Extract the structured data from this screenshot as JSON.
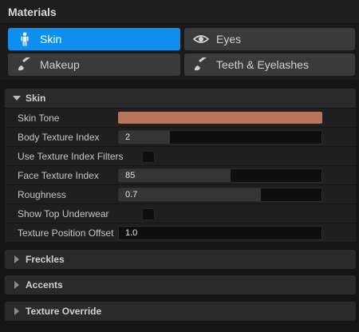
{
  "panel": {
    "title": "Materials"
  },
  "tabs": [
    {
      "label": "Skin",
      "icon": "person-icon",
      "active": true
    },
    {
      "label": "Eyes",
      "icon": "eye-icon",
      "active": false
    },
    {
      "label": "Makeup",
      "icon": "brush-icon",
      "active": false
    },
    {
      "label": "Teeth & Eyelashes",
      "icon": "brush-icon",
      "active": false
    }
  ],
  "skin_section": {
    "title": "Skin",
    "expanded": true,
    "properties": {
      "skin_tone": {
        "label": "Skin Tone",
        "color": "#b6765d"
      },
      "body_texture_index": {
        "label": "Body Texture Index",
        "value": "2",
        "fraction": 0.25
      },
      "use_texture_index_filters": {
        "label": "Use Texture Index Filters",
        "checked": false
      },
      "face_texture_index": {
        "label": "Face Texture Index",
        "value": "85",
        "fraction": 0.55
      },
      "roughness": {
        "label": "Roughness",
        "value": "0.7",
        "fraction": 0.7
      },
      "show_top_underwear": {
        "label": "Show Top Underwear",
        "checked": false
      },
      "texture_position_offset": {
        "label": "Texture Position Offset",
        "value": "1.0",
        "fraction": 0
      }
    }
  },
  "collapsed_sections": [
    {
      "title": "Freckles"
    },
    {
      "title": "Accents"
    },
    {
      "title": "Texture Override"
    }
  ],
  "colors": {
    "accent": "#0e8ff0",
    "panel_bg": "#151515",
    "section_bg": "#2a2a2a"
  }
}
